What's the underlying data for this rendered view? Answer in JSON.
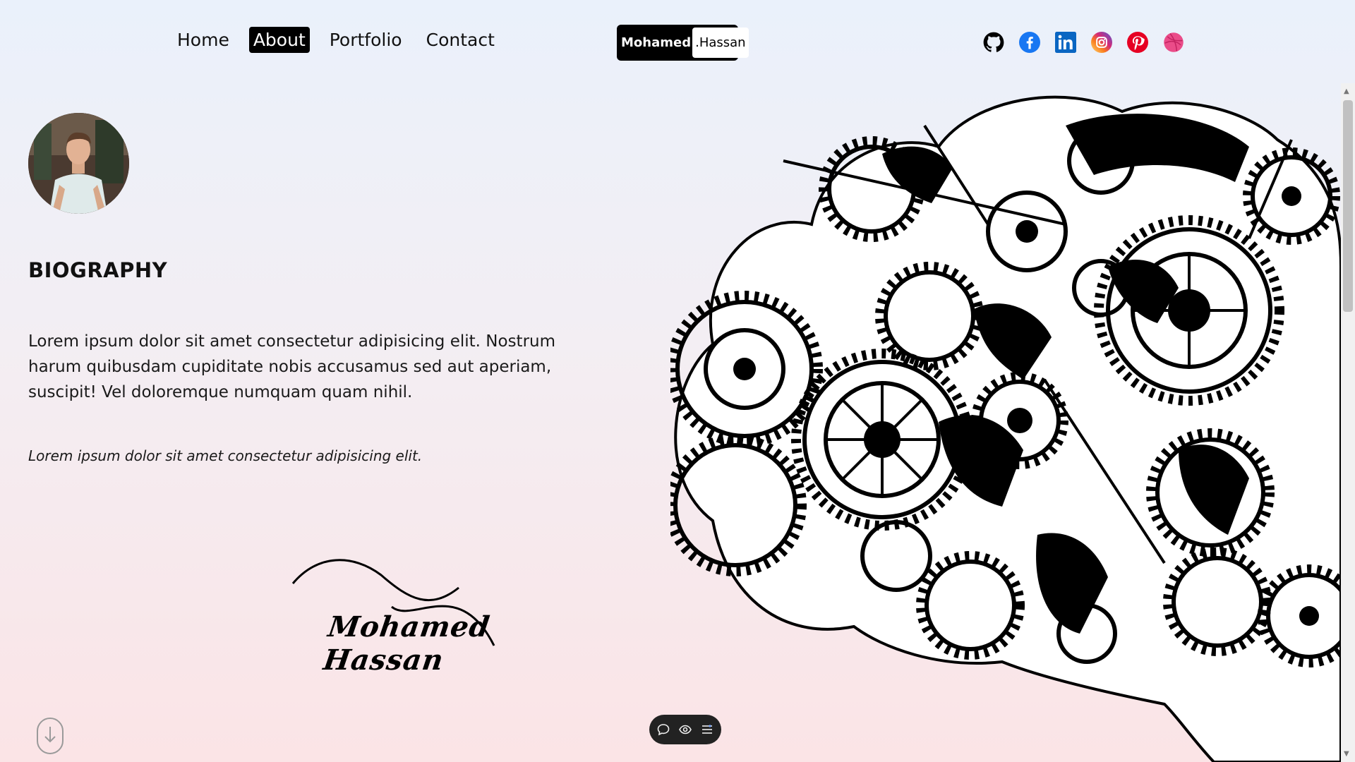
{
  "nav": {
    "items": [
      {
        "label": "Home",
        "active": false
      },
      {
        "label": "About",
        "active": true
      },
      {
        "label": "Portfolio",
        "active": false
      },
      {
        "label": "Contact",
        "active": false
      }
    ]
  },
  "logo": {
    "first": "Mohamed",
    "last": ".Hassan"
  },
  "socials": [
    {
      "icon": "github-icon",
      "color": "#000000"
    },
    {
      "icon": "facebook-icon",
      "color": "#1877f2"
    },
    {
      "icon": "linkedin-icon",
      "color": "#0a66c2"
    },
    {
      "icon": "instagram-icon",
      "color": "#d62976"
    },
    {
      "icon": "pinterest-icon",
      "color": "#e60023"
    },
    {
      "icon": "dribbble-icon",
      "color": "#ea4c89"
    }
  ],
  "about": {
    "heading": "BIOGRAPHY",
    "paragraph": "Lorem ipsum dolor sit amet consectetur adipisicing elit. Nostrum harum quibusdam cupiditate nobis accusamus sed aut aperiam, suscipit! Vel doloremque numquam quam nihil.",
    "quote": "Lorem ipsum dolor sit amet consectetur adipisicing elit.",
    "signature": "Mohamed Hassan"
  },
  "illustration": {
    "icon": "gear-brain-illustration"
  },
  "toolbar": {
    "icons": [
      "comment-icon",
      "eye-icon",
      "menu-icon"
    ]
  }
}
